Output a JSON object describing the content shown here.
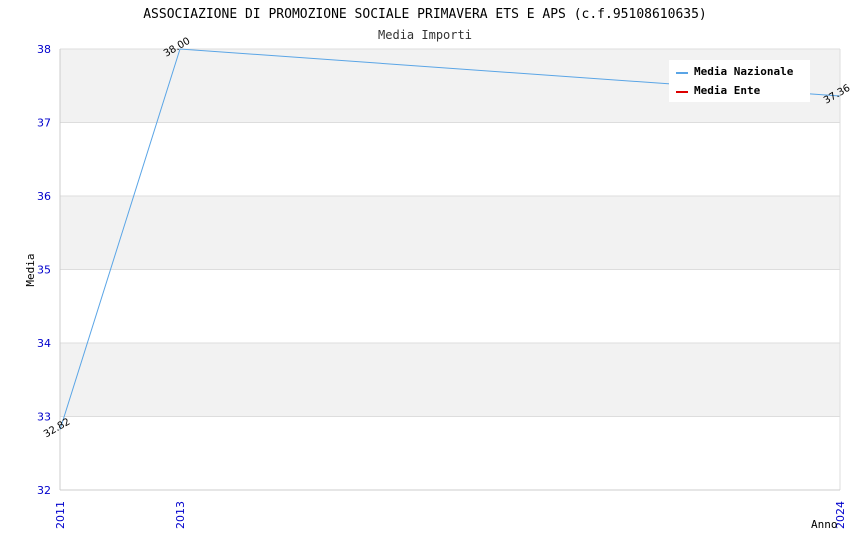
{
  "chart_data": {
    "type": "line",
    "title": "ASSOCIAZIONE DI PROMOZIONE SOCIALE PRIMAVERA ETS E APS (c.f.95108610635)",
    "subtitle": "Media Importi",
    "xlabel": "Anno",
    "ylabel": "Media",
    "x": [
      "2011",
      "2013",
      "2024"
    ],
    "x_numeric": [
      2011,
      2013,
      2024
    ],
    "ylim": [
      32,
      38
    ],
    "yticks": [
      "32",
      "33",
      "34",
      "35",
      "36",
      "37",
      "38"
    ],
    "grid": true,
    "legend_position": "top-right",
    "series": [
      {
        "name": "Media Nazionale",
        "color": "#5aa5e6",
        "values": [
          32.82,
          38.0,
          37.36
        ],
        "labels": [
          "32.82",
          "38.00",
          "37.36"
        ]
      },
      {
        "name": "Media Ente",
        "color": "#dd0000",
        "values": [],
        "labels": []
      }
    ]
  }
}
